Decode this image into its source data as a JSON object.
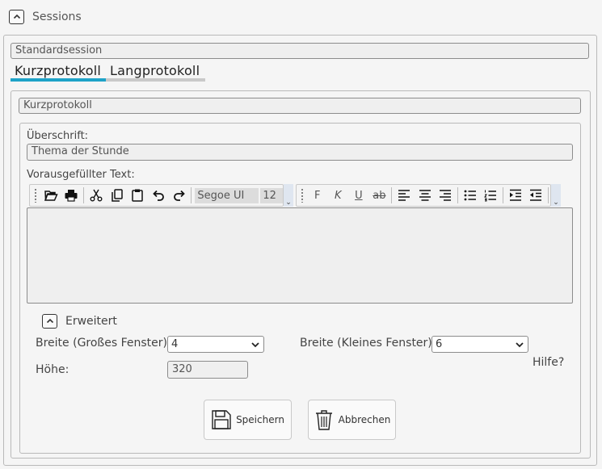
{
  "sessions": {
    "title": "Sessions"
  },
  "session_name": "Standardsession",
  "tabs": [
    {
      "label": "Kurzprotokoll",
      "active": true
    },
    {
      "label": "Langprotokoll",
      "active": false
    }
  ],
  "protocol_name": "Kurzprotokoll",
  "heading": {
    "label": "Überschrift:",
    "value": "Thema der Stunde"
  },
  "prefill": {
    "label": "Vorausgefüllter Text:"
  },
  "toolbar1": {
    "buttons": [
      "open-icon",
      "print-icon",
      "cut-icon",
      "copy-icon",
      "paste-icon",
      "undo-icon",
      "redo-icon"
    ],
    "font_family": "Segoe UI",
    "font_size": "12",
    "overflow": "⌄"
  },
  "toolbar2": {
    "bold": "F",
    "italic": "K",
    "underline": "U",
    "strike": "ab",
    "overflow": "⌄"
  },
  "advanced": {
    "title": "Erweitert",
    "width_large_label": "Breite (Großes Fenster)",
    "width_large_value": "4",
    "width_small_label": "Breite (Kleines Fenster)",
    "width_small_value": "6",
    "height_label": "Höhe:",
    "height_value": "320",
    "help": "Hilfe?"
  },
  "actions": {
    "save": "Speichern",
    "cancel": "Abbrechen"
  },
  "colors": {
    "accent": "#1ea3c8",
    "inactive_tab": "#c9c9c9"
  }
}
